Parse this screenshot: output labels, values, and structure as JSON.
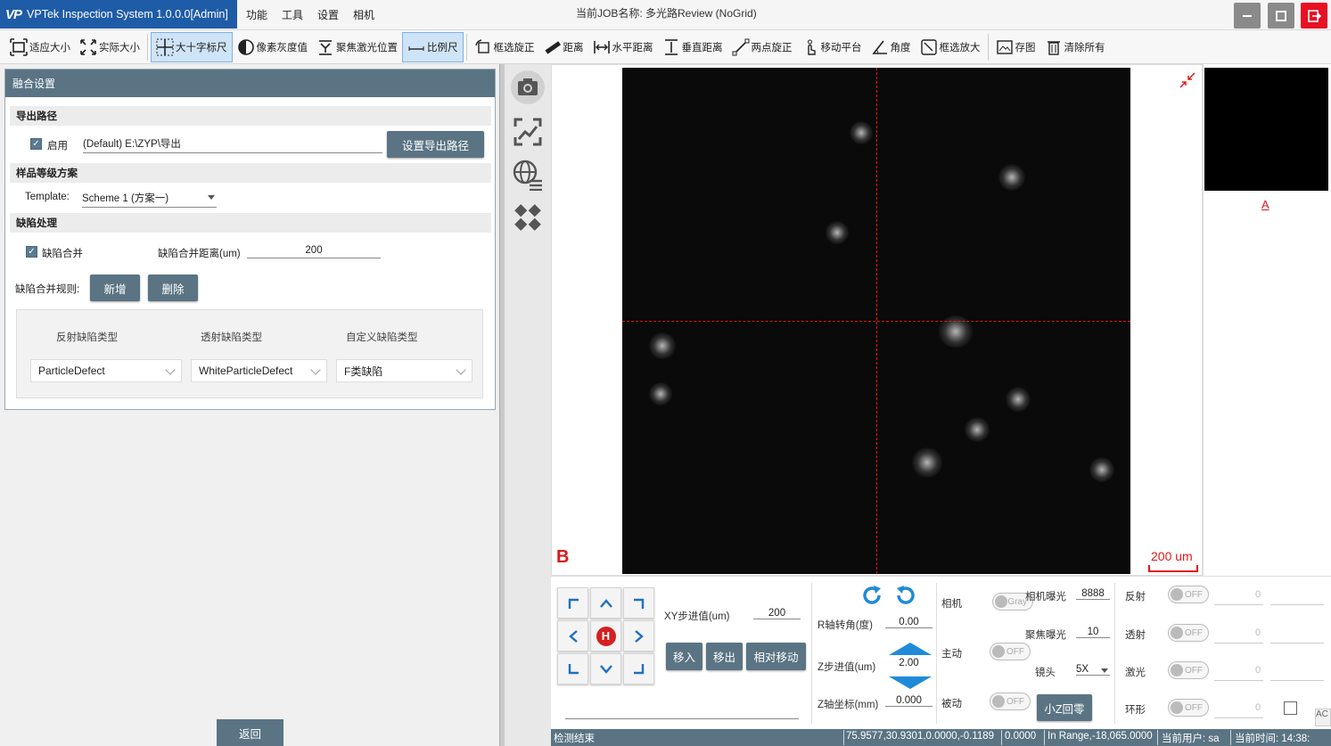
{
  "app": {
    "logo": "VP",
    "title": "VPTek Inspection System 1.0.0.0[Admin]",
    "job_title": "当前JOB名称: 多光路Review (NoGrid)"
  },
  "menu": [
    "功能",
    "工具",
    "设置",
    "相机"
  ],
  "toolbar": [
    {
      "label": "适应大小",
      "icon": "fit-size-icon"
    },
    {
      "label": "实际大小",
      "icon": "actual-size-icon"
    },
    {
      "label": "大十字标尺",
      "icon": "crosshair-ruler-icon",
      "active": true
    },
    {
      "label": "像素灰度值",
      "icon": "pixel-gray-icon"
    },
    {
      "label": "聚焦激光位置",
      "icon": "focus-laser-icon"
    },
    {
      "label": "比例尺",
      "icon": "scale-bar-icon",
      "active": true
    },
    {
      "label": "框选旋正",
      "icon": "box-rotate-icon"
    },
    {
      "label": "距离",
      "icon": "distance-icon"
    },
    {
      "label": "水平距离",
      "icon": "horizontal-distance-icon"
    },
    {
      "label": "垂直距离",
      "icon": "vertical-distance-icon"
    },
    {
      "label": "两点旋正",
      "icon": "two-point-rotate-icon"
    },
    {
      "label": "移动平台",
      "icon": "move-stage-icon"
    },
    {
      "label": "角度",
      "icon": "angle-icon"
    },
    {
      "label": "框选放大",
      "icon": "box-zoom-icon"
    },
    {
      "label": "存图",
      "icon": "save-image-icon"
    },
    {
      "label": "清除所有",
      "icon": "clear-all-icon"
    }
  ],
  "panel": {
    "header": "融合设置",
    "export_section": "导出路径",
    "enable_label": "启用",
    "enable_checked": true,
    "export_path": "(Default) E:\\ZYP\\导出",
    "set_path_button": "设置导出路径",
    "grade_section": "样品等级方案",
    "template_label": "Template:",
    "template_value": "Scheme 1 (方案一)",
    "defect_section": "缺陷处理",
    "merge_label": "缺陷合并",
    "merge_checked": true,
    "merge_distance_label": "缺陷合并距离(um)",
    "merge_distance_value": "200",
    "merge_rules_label": "缺陷合并规则:",
    "add_button": "新增",
    "delete_button": "删除",
    "grid": {
      "headers": [
        "反射缺陷类型",
        "透射缺陷类型",
        "自定义缺陷类型"
      ],
      "row": [
        "ParticleDefect",
        "WhiteParticleDefect",
        "F类缺陷"
      ]
    },
    "back_button": "返回"
  },
  "viewer": {
    "label_b": "B",
    "label_a": "A",
    "scale_label": "200 um"
  },
  "controls": {
    "home_label": "H",
    "xy_step_label": "XY步进值(um)",
    "xy_step_value": "200",
    "move_in": "移入",
    "move_out": "移出",
    "relative_move": "相对移动",
    "r_angle_label": "R轴转角(度)",
    "r_angle_value": "0.00",
    "z_step_label": "Z步进值(um)",
    "z_step_value": "2.00",
    "z_coord_label": "Z轴坐标(mm)",
    "z_coord_value": "0.000",
    "camera_label": "相机",
    "camera_toggle": "Gray",
    "active_label": "主动",
    "active_toggle": "OFF",
    "passive_label": "被动",
    "passive_toggle": "OFF",
    "small_z_home": "小Z回零",
    "cam_exposure_label": "相机曝光",
    "cam_exposure_value": "8888",
    "focus_exposure_label": "聚焦曝光",
    "focus_exposure_value": "10",
    "lens_label": "镜头",
    "lens_value": "5X",
    "reflect_label": "反射",
    "transmit_label": "透射",
    "laser_label": "激光",
    "ring_label": "环形",
    "off_text": "OFF",
    "zero_text": "0"
  },
  "status": {
    "left": "检测结束",
    "coords": "75.9577,30.9301,0.0000,-0.1189",
    "z": "0.0000",
    "range": "In Range,-18,065.0000",
    "user": "当前用户: sa",
    "time": "当前时间: 14:38:"
  },
  "ac_badge": "AC"
}
